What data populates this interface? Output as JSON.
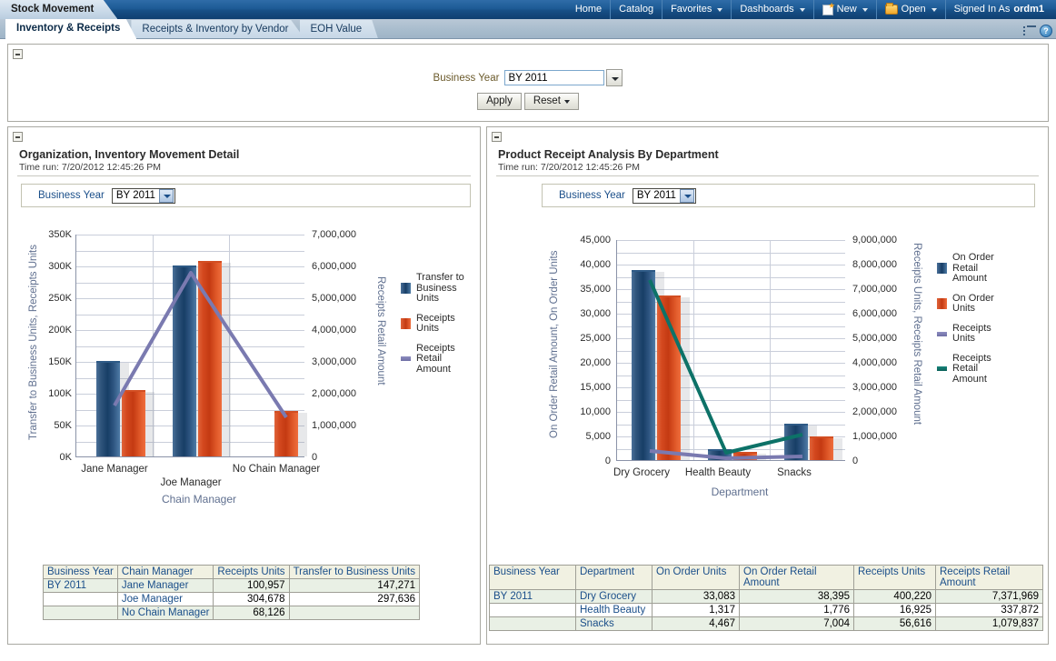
{
  "topbar": {
    "app_tab": "Stock Movement",
    "nav": [
      {
        "label": "Home",
        "icon": null,
        "caret": false
      },
      {
        "label": "Catalog",
        "icon": null,
        "caret": false
      },
      {
        "label": "Favorites",
        "icon": null,
        "caret": true
      },
      {
        "label": "Dashboards",
        "icon": null,
        "caret": true
      },
      {
        "label": "New",
        "icon": "new-page-icon",
        "caret": true
      },
      {
        "label": "Open",
        "icon": "folder-icon",
        "caret": true
      }
    ],
    "signed_in_label": "Signed In As",
    "signed_in_user": "ordm1"
  },
  "tabs": [
    {
      "label": "Inventory & Receipts",
      "active": true
    },
    {
      "label": "Receipts & Inventory by Vendor",
      "active": false
    },
    {
      "label": "EOH Value",
      "active": false
    }
  ],
  "tabrow_icons": [
    "page-options-icon",
    "help-icon"
  ],
  "help_icon_char": "?",
  "prompt": {
    "label": "Business Year",
    "value": "BY 2011",
    "placeholder": "BY 2011",
    "apply_label": "Apply",
    "reset_label": "Reset"
  },
  "left_report": {
    "title": "Organization, Inventory Movement Detail",
    "time_run": "Time run: 7/20/2012 12:45:26 PM",
    "selector_label": "Business Year",
    "selector_value": "BY 2011",
    "table": {
      "columns": [
        "Business Year",
        "Chain Manager",
        "Receipts Units",
        "Transfer to Business Units"
      ],
      "rows": [
        [
          "BY 2011",
          "Jane Manager",
          "100,957",
          "147,271"
        ],
        [
          "",
          "Joe Manager",
          "304,678",
          "297,636"
        ],
        [
          "",
          "No Chain Manager",
          "68,126",
          ""
        ]
      ]
    }
  },
  "right_report": {
    "title": "Product Receipt Analysis By Department",
    "time_run": "Time run: 7/20/2012 12:45:26 PM",
    "selector_label": "Business Year",
    "selector_value": "BY 2011",
    "table": {
      "columns": [
        "Business Year",
        "Department",
        "On Order Units",
        "On Order Retail Amount",
        "Receipts Units",
        "Receipts Retail Amount"
      ],
      "rows": [
        [
          "BY 2011",
          "Dry Grocery",
          "33,083",
          "38,395",
          "400,220",
          "7,371,969"
        ],
        [
          "",
          "Health Beauty",
          "1,317",
          "1,776",
          "16,925",
          "337,872"
        ],
        [
          "",
          "Snacks",
          "4,467",
          "7,004",
          "56,616",
          "1,079,837"
        ]
      ]
    }
  },
  "chart_data": [
    {
      "id": "inventory-movement-chart",
      "type": "bar",
      "title": "Organization, Inventory Movement Detail",
      "xlabel": "Chain Manager",
      "ylabel": "Transfer to Business Units, Receipts Units",
      "y2label": "Receipts Retail Amount",
      "categories": [
        "Jane Manager",
        "Joe Manager",
        "No Chain Manager"
      ],
      "ylim": [
        0,
        350000
      ],
      "yticks": [
        "0K",
        "50K",
        "100K",
        "150K",
        "200K",
        "250K",
        "300K",
        "350K"
      ],
      "ytick_values": [
        0,
        50000,
        100000,
        150000,
        200000,
        250000,
        300000,
        350000
      ],
      "y2lim": [
        0,
        7000000
      ],
      "y2ticks": [
        "0",
        "1,000,000",
        "2,000,000",
        "3,000,000",
        "4,000,000",
        "5,000,000",
        "6,000,000",
        "7,000,000"
      ],
      "y2tick_values": [
        0,
        1000000,
        2000000,
        3000000,
        4000000,
        5000000,
        6000000,
        7000000
      ],
      "grid": true,
      "legend_position": "right",
      "series": [
        {
          "name": "Transfer to Business Units",
          "kind": "bar",
          "axis": "left",
          "color": "#1f4a77",
          "values": [
            147271,
            297636,
            null
          ]
        },
        {
          "name": "Receipts Units",
          "kind": "bar",
          "axis": "left",
          "color": "#c43a12",
          "values": [
            100957,
            304678,
            68126
          ]
        },
        {
          "name": "Receipts Retail Amount",
          "kind": "line",
          "axis": "right",
          "color": "#7a7ab0",
          "values": [
            1620000,
            5800000,
            1260000
          ]
        }
      ]
    },
    {
      "id": "product-receipt-chart",
      "type": "bar",
      "title": "Product Receipt Analysis By Department",
      "xlabel": "Department",
      "ylabel": "On Order Retail Amount, On Order Units",
      "y2label": "Receipts Units, Receipts Retail Amount",
      "categories": [
        "Dry Grocery",
        "Health Beauty",
        "Snacks"
      ],
      "ylim": [
        0,
        45000
      ],
      "yticks": [
        "0",
        "5,000",
        "10,000",
        "15,000",
        "20,000",
        "25,000",
        "30,000",
        "35,000",
        "40,000",
        "45,000"
      ],
      "ytick_values": [
        0,
        5000,
        10000,
        15000,
        20000,
        25000,
        30000,
        35000,
        40000,
        45000
      ],
      "y2lim": [
        0,
        9000000
      ],
      "y2ticks": [
        "0",
        "1,000,000",
        "2,000,000",
        "3,000,000",
        "4,000,000",
        "5,000,000",
        "6,000,000",
        "7,000,000",
        "8,000,000",
        "9,000,000"
      ],
      "y2tick_values": [
        0,
        1000000,
        2000000,
        3000000,
        4000000,
        5000000,
        6000000,
        7000000,
        8000000,
        9000000
      ],
      "grid": true,
      "legend_position": "right",
      "series": [
        {
          "name": "On Order Retail Amount",
          "kind": "bar",
          "axis": "left",
          "color": "#1f4a77",
          "values": [
            38395,
            1776,
            7004
          ]
        },
        {
          "name": "On Order Units",
          "kind": "bar",
          "axis": "left",
          "color": "#c43a12",
          "values": [
            33083,
            1317,
            4467
          ]
        },
        {
          "name": "Receipts Units",
          "kind": "line",
          "axis": "right",
          "color": "#7a7ab0",
          "values": [
            400220,
            16925,
            56616
          ]
        },
        {
          "name": "Receipts Retail Amount",
          "kind": "line",
          "axis": "right",
          "color": "#0d7268",
          "values": [
            7371969,
            337872,
            1079837
          ]
        }
      ]
    }
  ]
}
